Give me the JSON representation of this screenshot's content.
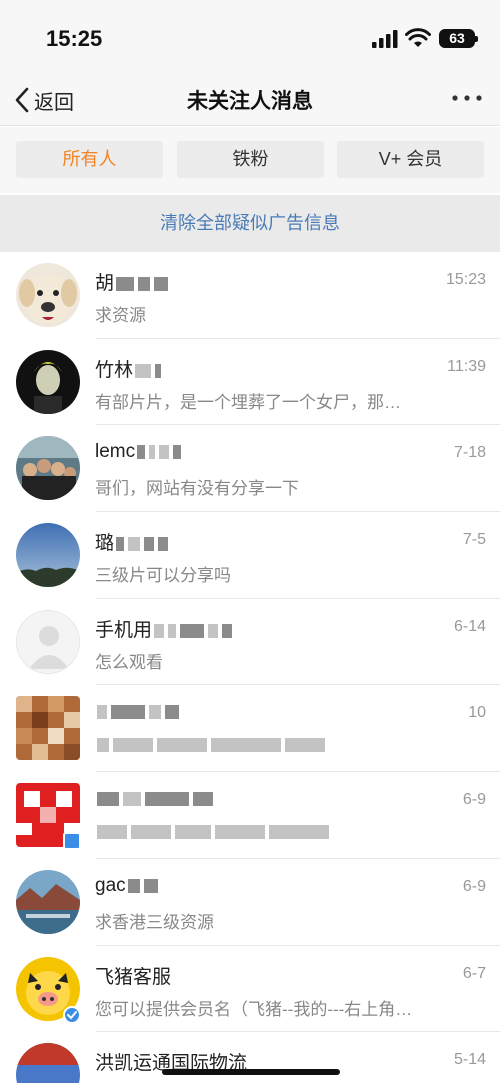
{
  "status_bar": {
    "time": "15:25",
    "battery": "63"
  },
  "nav": {
    "back_label": "返回",
    "title": "未关注人消息"
  },
  "tabs": [
    {
      "label": "所有人",
      "active": true
    },
    {
      "label": "铁粉",
      "active": false
    },
    {
      "label": "V+ 会员",
      "active": false
    }
  ],
  "clear_banner": "清除全部疑似广告信息",
  "conversations": [
    {
      "name": "胡",
      "message": "求资源",
      "time": "15:23"
    },
    {
      "name": "竹林",
      "message": "有部片片，是一个埋葬了一个女尸，那…",
      "time": "11:39"
    },
    {
      "name": "lemc",
      "message": "哥们，网站有没有分享一下",
      "time": "7-18"
    },
    {
      "name": "璐",
      "message": "三级片可以分享吗",
      "time": "7-5"
    },
    {
      "name": "手机用",
      "message": "怎么观看",
      "time": "6-14"
    },
    {
      "name": "",
      "message": "",
      "time": "10"
    },
    {
      "name": "",
      "message": "",
      "time": "6-9"
    },
    {
      "name": "gac",
      "message": "求香港三级资源",
      "time": "6-9"
    },
    {
      "name": "飞猪客服",
      "message": "您可以提供会员名（飞猪--我的---右上角…",
      "time": "6-7"
    },
    {
      "name": "洪凯运通国际物流",
      "message": "",
      "time": "5-14"
    }
  ],
  "colors": {
    "accent": "#f58220",
    "link": "#4a7bb5",
    "verified": "#3a8ee6"
  }
}
